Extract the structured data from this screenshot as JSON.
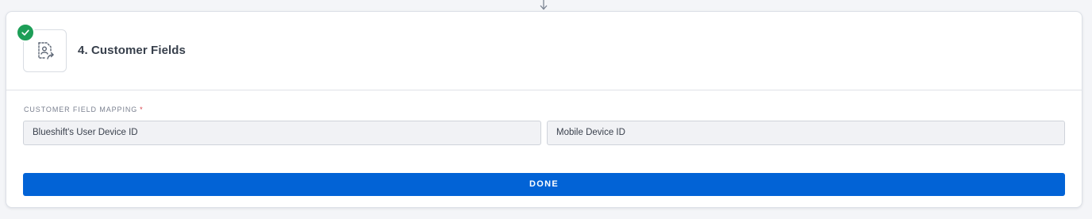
{
  "step": {
    "title": "4. Customer Fields",
    "status": "completed",
    "icon": "contact-mapping-icon",
    "status_icon": "check-icon",
    "status_color": "#1d9e57"
  },
  "mapping": {
    "label": "CUSTOMER FIELD MAPPING",
    "required_marker": "*",
    "source_field": "Blueshift's User Device ID",
    "destination_field": "Mobile Device ID"
  },
  "actions": {
    "done_label": "DONE",
    "done_color": "#0263d6"
  }
}
